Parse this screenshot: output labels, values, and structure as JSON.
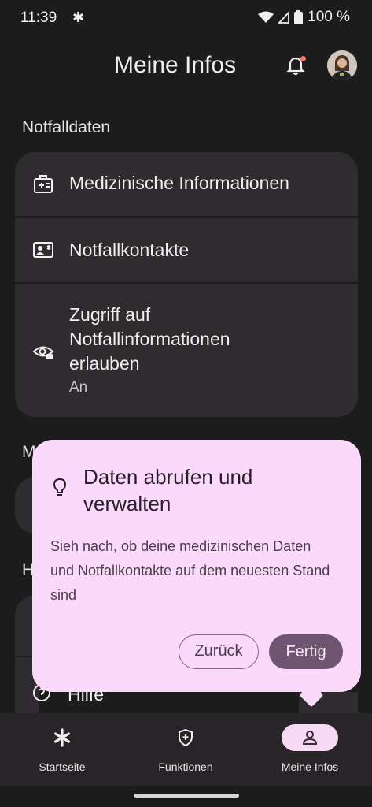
{
  "status_bar": {
    "time": "11:39",
    "battery": "100 %"
  },
  "header": {
    "title": "Meine Infos"
  },
  "emergency": {
    "section_title": "Notfalldaten",
    "items": [
      {
        "label": "Medizinische Informationen"
      },
      {
        "label": "Notfallkontakte"
      },
      {
        "label": "Zugriff auf Notfallinformationen erlauben",
        "sub": "An"
      }
    ]
  },
  "hidden_sections": [
    {
      "visible_text": "M"
    },
    {
      "visible_text": "H"
    },
    {
      "visible_text": "Hilfe"
    }
  ],
  "popup": {
    "title": "Daten abrufen und verwalten",
    "body": "Sieh nach, ob deine medizinischen Daten und Notfallkontakte auf dem neuesten Stand sind",
    "back_label": "Zurück",
    "done_label": "Fertig"
  },
  "bottom_nav": [
    {
      "label": "Startseite",
      "icon": "asterisk-icon"
    },
    {
      "label": "Funktionen",
      "icon": "shield-plus-icon"
    },
    {
      "label": "Meine Infos",
      "icon": "person-icon",
      "active": true
    }
  ],
  "colors": {
    "background": "#1c1c1c",
    "card": "#2e2c2e",
    "popup": "#fbd9fb",
    "primary_button": "#6f5570",
    "active_nav_pill": "#f7d9f6",
    "notification_dot": "#ff6f61"
  }
}
